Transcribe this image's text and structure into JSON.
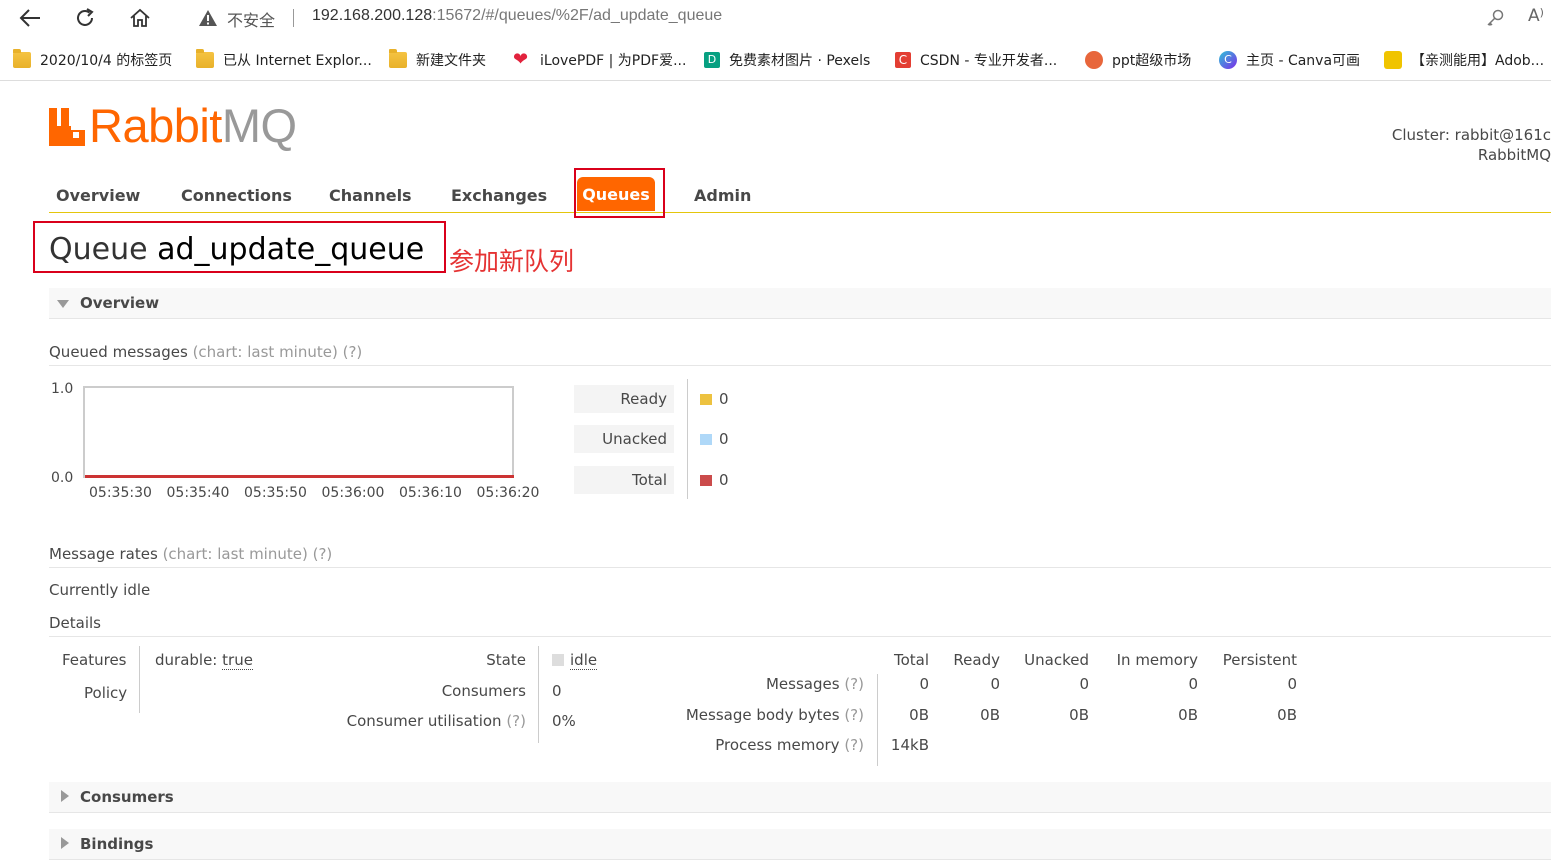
{
  "browser": {
    "security_label": "不安全",
    "url_host": "192.168.200.128",
    "url_rest": ":15672/#/queues/%2F/ad_update_queue",
    "bookmarks": [
      "2020/10/4 的标签页",
      "已从 Internet Explor...",
      "新建文件夹",
      "iLovePDF | 为PDF爱...",
      "免费素材图片 · Pexels",
      "CSDN - 专业开发者...",
      "ppt超级市场",
      "主页 - Canva可画",
      "【亲测能用】Adob..."
    ]
  },
  "header": {
    "logo_left": "RabbitMQ",
    "logo_rabbit": "Rabbit",
    "logo_mq": "MQ",
    "cluster_label": "Cluster:",
    "cluster_value": "rabbit@161c",
    "cluster_sub": "RabbitMQ"
  },
  "tabs": [
    "Overview",
    "Connections",
    "Channels",
    "Exchanges",
    "Queues",
    "Admin"
  ],
  "page": {
    "title_prefix": "Queue",
    "queue_name": "ad_update_queue",
    "annotation": "参加新队列"
  },
  "overview": {
    "section_label": "Overview",
    "queued_label": "Queued messages",
    "queued_hint": "(chart: last minute) (?)",
    "rates_label": "Message rates",
    "rates_hint": "(chart: last minute) (?)",
    "idle_text": "Currently idle",
    "details_label": "Details"
  },
  "chart_data": {
    "type": "line",
    "x": [
      "05:35:30",
      "05:35:40",
      "05:35:50",
      "05:36:00",
      "05:36:10",
      "05:36:20"
    ],
    "series": [
      {
        "name": "Ready",
        "values": [
          0,
          0,
          0,
          0,
          0,
          0
        ]
      },
      {
        "name": "Unacked",
        "values": [
          0,
          0,
          0,
          0,
          0,
          0
        ]
      },
      {
        "name": "Total",
        "values": [
          0,
          0,
          0,
          0,
          0,
          0
        ]
      }
    ],
    "ylim": [
      0.0,
      1.0
    ],
    "y_ticks": [
      "1.0",
      "0.0"
    ]
  },
  "legend": [
    {
      "label": "Ready",
      "value": "0",
      "color": "#edc240"
    },
    {
      "label": "Unacked",
      "value": "0",
      "color": "#afd8f8"
    },
    {
      "label": "Total",
      "value": "0",
      "color": "#cb4b4b"
    }
  ],
  "details": {
    "features_label": "Features",
    "features_key": "durable:",
    "features_val": "true",
    "policy_label": "Policy",
    "state_label": "State",
    "state_val": "idle",
    "consumers_label": "Consumers",
    "consumers_val": "0",
    "util_label": "Consumer utilisation",
    "util_hint": "(?)",
    "util_val": "0%",
    "cols": [
      "Total",
      "Ready",
      "Unacked",
      "In memory",
      "Persistent"
    ],
    "rows": [
      {
        "label": "Messages",
        "hint": "(?)",
        "values": [
          "0",
          "0",
          "0",
          "0",
          "0"
        ]
      },
      {
        "label": "Message body bytes",
        "hint": "(?)",
        "values": [
          "0B",
          "0B",
          "0B",
          "0B",
          "0B"
        ]
      },
      {
        "label": "Process memory",
        "hint": "(?)",
        "values": [
          "14kB"
        ]
      }
    ]
  },
  "sections": {
    "consumers": "Consumers",
    "bindings": "Bindings"
  }
}
